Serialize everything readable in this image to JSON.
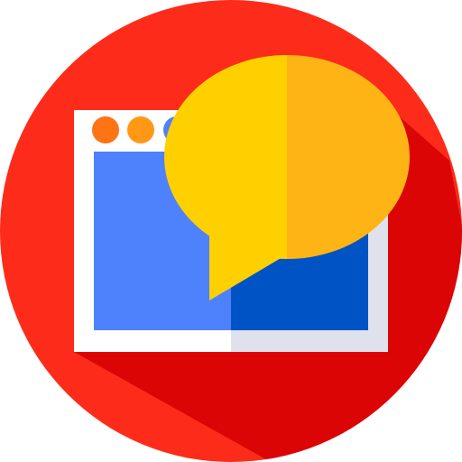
{
  "icon": {
    "name": "browser-chat-icon",
    "colors": {
      "circle": "#fd2c1a",
      "circle_shadow": "#dc0505",
      "window_frame_light": "#ffffff",
      "window_frame_shade": "#dfe2ec",
      "screen_left": "#4e81fc",
      "screen_right": "#0053c4",
      "dot_1": "#fe7314",
      "dot_2": "#ff9915",
      "dot_3": "#4e81fc",
      "bubble_left": "#ffd000",
      "bubble_right": "#feb415"
    }
  }
}
